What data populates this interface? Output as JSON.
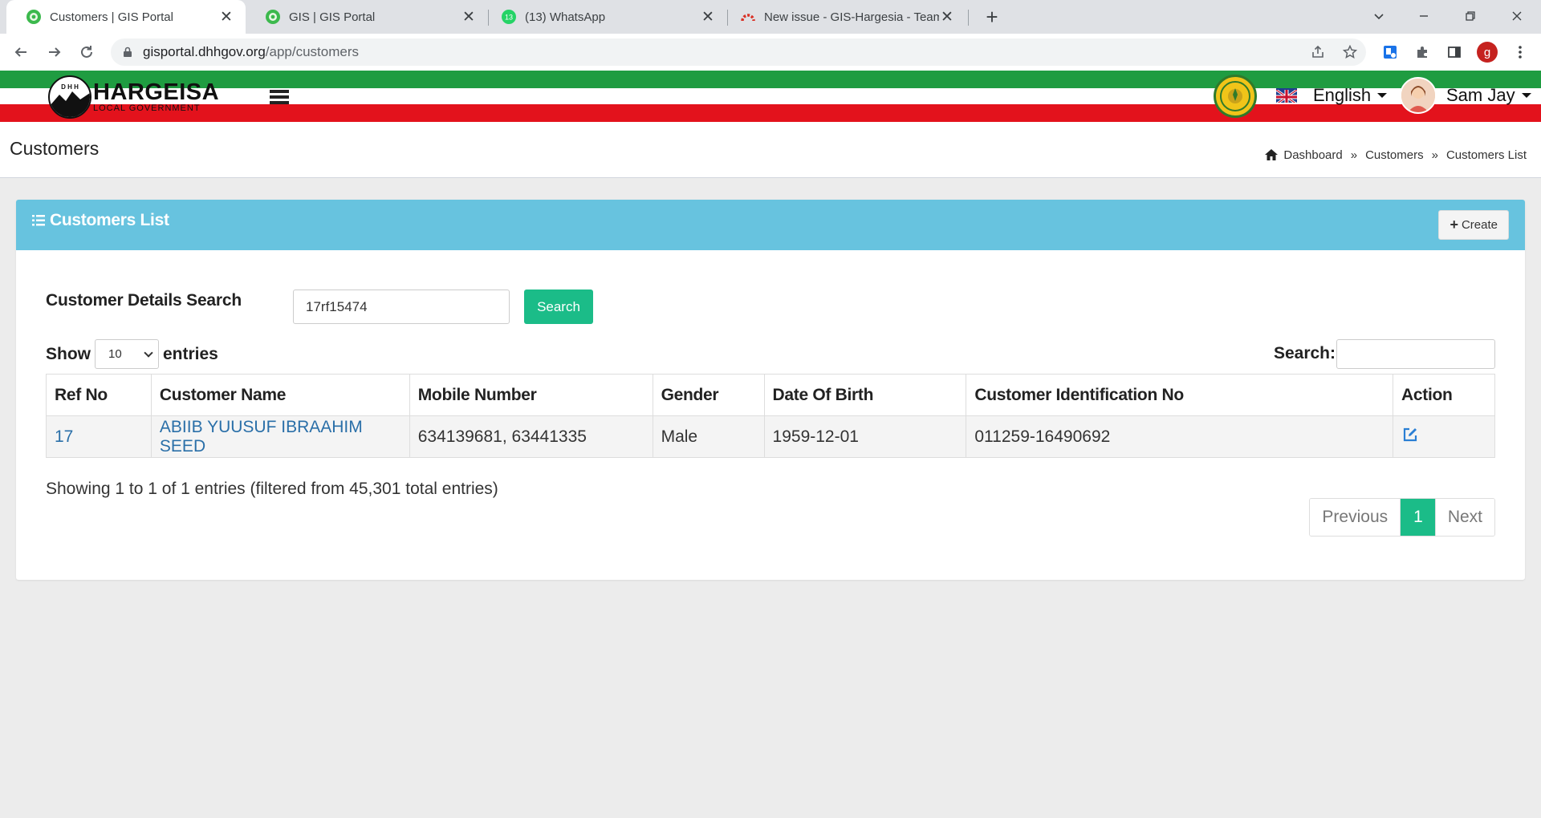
{
  "browser": {
    "tabs": [
      {
        "title": "Customers | GIS Portal",
        "active": true
      },
      {
        "title": "GIS | GIS Portal",
        "active": false
      },
      {
        "title": "(13) WhatsApp",
        "active": false,
        "badge": "13"
      },
      {
        "title": "New issue - GIS-Hargesia - Team",
        "active": false
      }
    ],
    "url_host": "gisportal.dhhgov.org",
    "url_path": "/app/customers",
    "profile_letter": "g"
  },
  "header": {
    "logo_title": "HARGEISA",
    "logo_subtitle": "LOCAL GOVERNMENT",
    "logo_initials": "D H H",
    "language": "English",
    "user_name": "Sam Jay",
    "colors": {
      "green": "#1f9c41",
      "red": "#e3121c",
      "accent": "#67c3df",
      "success": "#1bbc88"
    }
  },
  "page": {
    "title": "Customers",
    "breadcrumb": [
      "Dashboard",
      "Customers",
      "Customers List"
    ]
  },
  "card": {
    "title": "Customers List",
    "create_label": "Create",
    "search_label": "Customer Details Search",
    "search_value": "17rf15474",
    "search_button": "Search",
    "show_label": "Show",
    "entries_label": "entries",
    "page_length": "10",
    "filter_label": "Search:",
    "filter_value": "",
    "columns": [
      "Ref No",
      "Customer Name",
      "Mobile Number",
      "Gender",
      "Date Of Birth",
      "Customer Identification No",
      "Action"
    ],
    "rows": [
      {
        "ref": "17",
        "name": "ABIIB YUUSUF IBRAAHIM SEED",
        "mobile": "634139681, 63441335",
        "gender": "Male",
        "dob": "1959-12-01",
        "cid": "011259-16490692"
      }
    ],
    "info": "Showing 1 to 1 of 1 entries (filtered from 45,301 total entries)",
    "pager": {
      "previous": "Previous",
      "current": "1",
      "next": "Next"
    }
  }
}
